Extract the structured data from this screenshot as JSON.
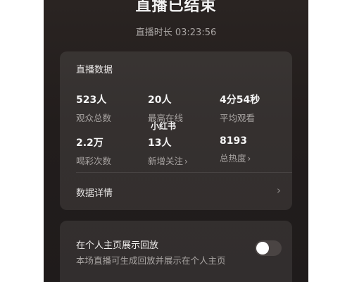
{
  "header": {
    "title": "直播已结束",
    "duration": "直播时长 03:23:56"
  },
  "live_data": {
    "title": "直播数据",
    "stats": [
      {
        "value": "523人",
        "label": "观众总数"
      },
      {
        "value": "20人",
        "label": "最高在线"
      },
      {
        "value": "4分54秒",
        "label": "平均观看"
      },
      {
        "value": "2.2万",
        "label": "喝彩次数"
      },
      {
        "value": "13人",
        "label": "新增关注"
      },
      {
        "value": "8193",
        "label": "总热度"
      }
    ],
    "chevron": "›",
    "details_label": "数据详情",
    "details_chevron": "›"
  },
  "watermark": "小红书",
  "replay": {
    "title": "在个人主页展示回放",
    "description": "本场直播可生成回放并展示在个人主页",
    "toggle_on": false
  }
}
